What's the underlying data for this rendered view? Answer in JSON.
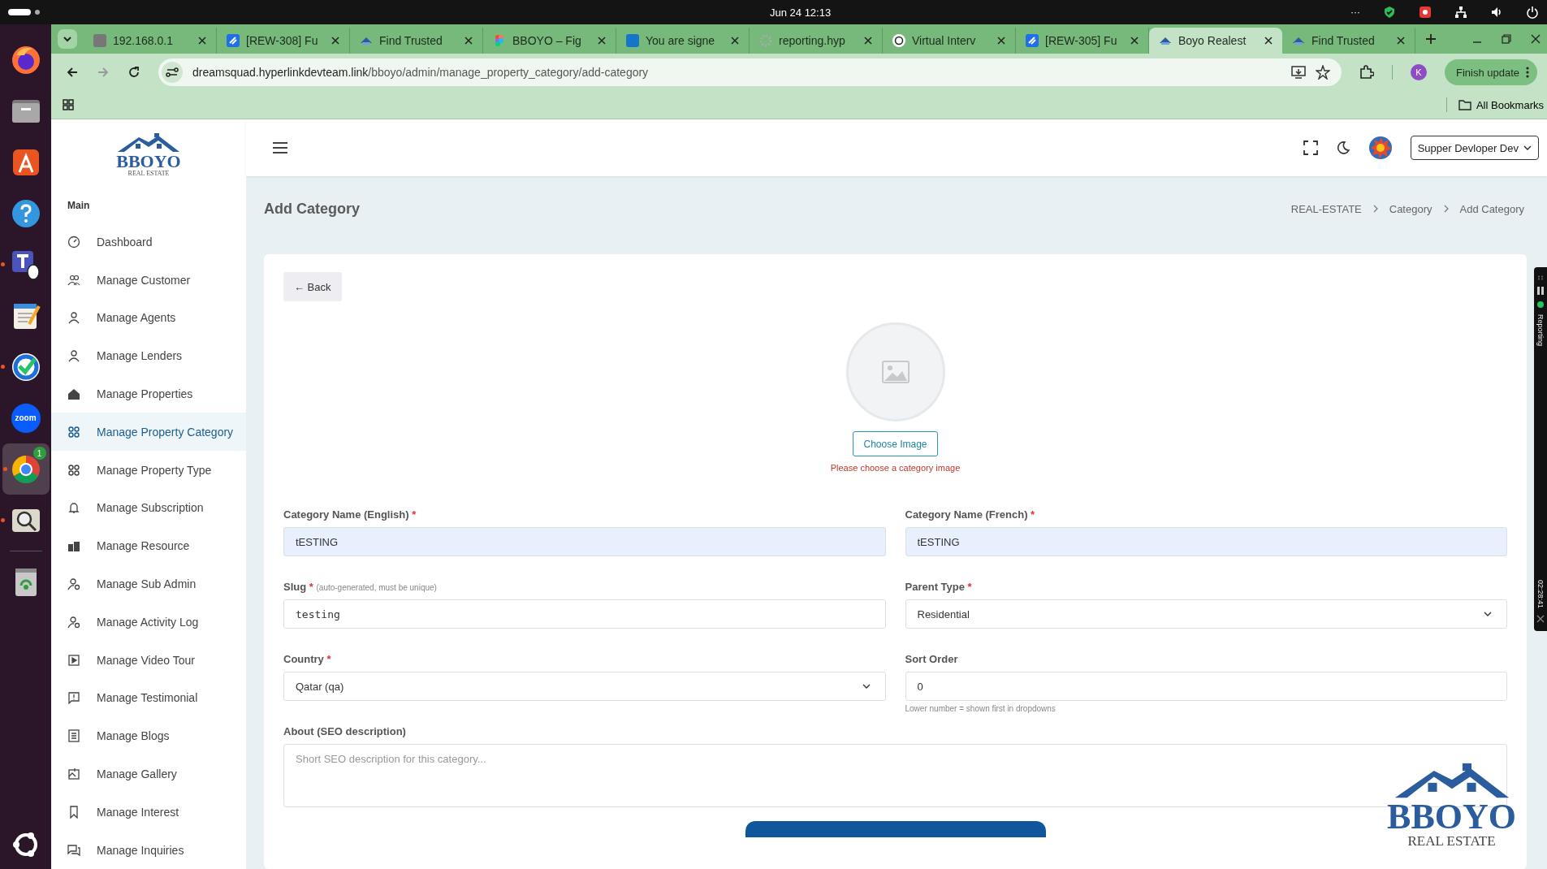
{
  "system_bar": {
    "date_time": "Jun 24  12:13",
    "overflow": "···"
  },
  "dock": {
    "items": [
      {
        "kind": "firefox",
        "running": false
      },
      {
        "kind": "files",
        "running": false
      },
      {
        "kind": "store",
        "running": false
      },
      {
        "kind": "help",
        "running": false
      },
      {
        "kind": "teams",
        "running": true
      },
      {
        "kind": "editor",
        "running": false
      },
      {
        "kind": "check",
        "running": true
      },
      {
        "kind": "zoom",
        "running": false,
        "label": "zoom"
      },
      {
        "kind": "chrome",
        "running": true,
        "badge": "1"
      },
      {
        "kind": "viewer",
        "running": true
      },
      {
        "kind": "trash",
        "running": false
      }
    ],
    "apps_button": {
      "kind": "ubuntu"
    }
  },
  "browser": {
    "tabs": [
      {
        "title": "192.168.0.1",
        "selected": false
      },
      {
        "title": "[REW-308] Fu",
        "selected": false
      },
      {
        "title": "Find Trusted",
        "selected": false
      },
      {
        "title": "BBOYO – Fig",
        "selected": false
      },
      {
        "title": "You are signe",
        "selected": false
      },
      {
        "title": "reporting.hyp",
        "selected": false
      },
      {
        "title": "Virtual Interv",
        "selected": false
      },
      {
        "title": "[REW-305] Fu",
        "selected": false
      },
      {
        "title": "Boyo Realest",
        "selected": true
      },
      {
        "title": "Find Trusted",
        "selected": false
      }
    ],
    "address": {
      "host": "dreamsquad.hyperlinkdevteam.link",
      "path": "/bboyo/admin/manage_property_category/add-category"
    },
    "profile_initial": "K",
    "update_button": "Finish update",
    "bookmarks_folder": "All Bookmarks"
  },
  "logo": {
    "name": "BBOYO",
    "tagline": "REAL ESTATE"
  },
  "sidebar": {
    "section": "Main",
    "items": [
      {
        "label": "Dashboard",
        "selected": false
      },
      {
        "label": "Manage Customer",
        "selected": false
      },
      {
        "label": "Manage Agents",
        "selected": false
      },
      {
        "label": "Manage Lenders",
        "selected": false
      },
      {
        "label": "Manage Properties",
        "selected": false
      },
      {
        "label": "Manage Property Category",
        "selected": true
      },
      {
        "label": "Manage Property Type",
        "selected": false
      },
      {
        "label": "Manage Subscription",
        "selected": false
      },
      {
        "label": "Manage Resource",
        "selected": false
      },
      {
        "label": "Manage Sub Admin",
        "selected": false
      },
      {
        "label": "Manage Activity Log",
        "selected": false
      },
      {
        "label": "Manage Video Tour",
        "selected": false
      },
      {
        "label": "Manage Testimonial",
        "selected": false
      },
      {
        "label": "Manage Blogs",
        "selected": false
      },
      {
        "label": "Manage Gallery",
        "selected": false
      },
      {
        "label": "Manage Interest",
        "selected": false
      },
      {
        "label": "Manage Inquiries",
        "selected": false
      }
    ]
  },
  "header": {
    "user": "Supper Devloper Dev"
  },
  "page_title": "Add Category",
  "breadcrumbs": [
    "REAL-ESTATE",
    "Category",
    "Add Category"
  ],
  "form": {
    "back_button": "← Back",
    "image": {
      "button": "Choose Image",
      "error": "Please choose a category image"
    },
    "fields": [
      {
        "kind": "text",
        "label": "Category Name (English)",
        "required_mark": "*",
        "value": "tESTING",
        "autofilled": true
      },
      {
        "kind": "text",
        "label": "Category Name (French)",
        "required_mark": "*",
        "value": "tESTING",
        "autofilled": true
      },
      {
        "kind": "mono",
        "label": "Slug",
        "required_mark": "*",
        "hint": "(auto-generated, must be unique)",
        "value": "testing",
        "autofilled": false
      },
      {
        "kind": "select",
        "label": "Parent Type",
        "required_mark": "*",
        "value": "Residential",
        "autofilled": false
      },
      {
        "kind": "select",
        "label": "Country",
        "required_mark": "*",
        "value": "Qatar (qa)",
        "autofilled": false
      },
      {
        "kind": "text",
        "label": "Sort Order",
        "value": "0",
        "help": "Lower number = shown first in dropdowns",
        "autofilled": false
      },
      {
        "kind": "textarea",
        "label": "About (SEO description)",
        "placeholder": "Short SEO description for this category...",
        "autofilled": false
      }
    ]
  },
  "floating_logo": {
    "name": "BBOYO",
    "tagline": "REAL ESTATE"
  },
  "recorder": {
    "label": "Reporting",
    "time": "02:28:41"
  }
}
